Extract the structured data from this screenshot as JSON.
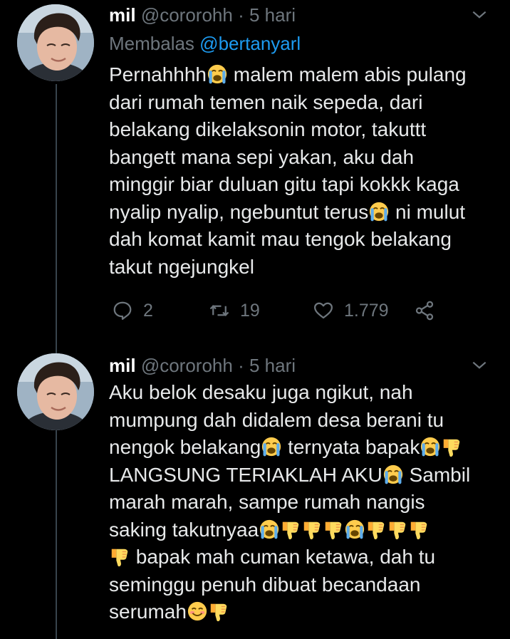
{
  "colors": {
    "background": "#000000",
    "text": "#e7e9ea",
    "secondary": "#6e767d",
    "link": "#1d9bf0",
    "thread_line": "#38444d"
  },
  "tweets": [
    {
      "author": {
        "name": "mil",
        "handle": "@cororohh",
        "time": "5 hari",
        "avatar_icon": "avatar-photo"
      },
      "replying_prefix": "Membalas",
      "replying_to": "@bertanyarl",
      "segments": [
        {
          "t": "Pernahhhh"
        },
        {
          "e": "crying"
        },
        {
          "t": " malem malem abis pulang\ndari rumah temen naik sepeda, dari\nbelakang dikelaksonin motor, takuttt\nbangett mana sepi yakan, aku dah\nminggir biar duluan gitu tapi kokkk kaga\nnyalip nyalip, ngebuntut terus"
        },
        {
          "e": "crying"
        },
        {
          "t": " ni mulut\ndah komat kamit mau tengok belakang\ntakut ngejungkel"
        }
      ],
      "stats": {
        "replies": "2",
        "retweets": "19",
        "likes": "1.779"
      }
    },
    {
      "author": {
        "name": "mil",
        "handle": "@cororohh",
        "time": "5 hari",
        "avatar_icon": "avatar-photo"
      },
      "segments": [
        {
          "t": "Aku belok desaku juga ngikut, nah\nmumpung dah didalem desa berani tu\nnengok belakang"
        },
        {
          "e": "crying"
        },
        {
          "t": " ternyata bapak"
        },
        {
          "e": "crying"
        },
        {
          "e": "thumbsdown"
        },
        {
          "t": "\nLANGSUNG TERIAKLAH AKU"
        },
        {
          "e": "crying"
        },
        {
          "t": " Sambil\nmarah marah, sampe rumah nangis\nsaking takutnyaa"
        },
        {
          "e": "crying"
        },
        {
          "e": "thumbsdown"
        },
        {
          "e": "thumbsdown"
        },
        {
          "e": "thumbsdown"
        },
        {
          "e": "crying"
        },
        {
          "e": "thumbsdown"
        },
        {
          "e": "thumbsdown"
        },
        {
          "e": "thumbsdown"
        },
        {
          "t": "\n"
        },
        {
          "e": "thumbsdown"
        },
        {
          "t": " bapak mah cuman ketawa, dah tu\nseminggu penuh dibuat becandaan\nserumah"
        },
        {
          "e": "smiling"
        },
        {
          "e": "thumbsdown"
        }
      ]
    }
  ]
}
